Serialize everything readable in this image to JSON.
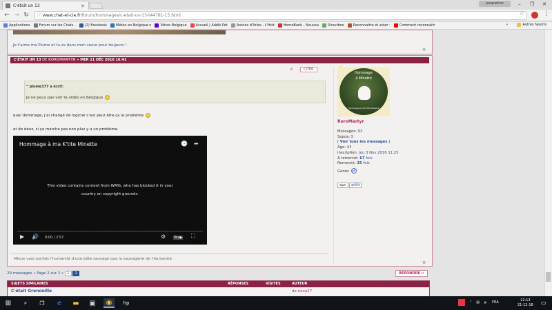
{
  "browser": {
    "tab_title": "C'était un 13",
    "user_chip": "Jacqueline",
    "url_host": "www.chat-et-cie.fr",
    "url_path": "/forum/hommages/c-etait-un-13-t44781-15.html",
    "bookmarks": [
      "Applications",
      "Forum sur les Chats -",
      "(2) Facebook",
      "Météo en Belgique n",
      "Yahoo Belgique",
      "Accueil | Addik Pet",
      "Arènes d'Arles - L'Hist",
      "HomeBank - Nouvea",
      "Shoutbox",
      "Reconnaitre et aider :",
      "Comment reconnaitr"
    ],
    "bookmarks_overflow": "»",
    "other_bookmarks": "Autres favoris"
  },
  "prev_post": {
    "signature": "Je t'aime ma Plume et tu es dans mon coeur pour toujours !"
  },
  "post": {
    "title": "C'ÉTAIT UN 13",
    "by": "DE",
    "author": "ROROMARTYR",
    "date": "» MER 21 DÉC 2016 16:41",
    "cite": "CITER",
    "quote_author": "plume377 a écrit:",
    "quote_text": "Je ne peux pas voir ta vidéo en Belgique",
    "para1": "quel dommage, j'ai changé de logiciel c'est peut être ça le problème",
    "para2": "et de deuz, si ça marche pas non plus y a un problème.",
    "video_title": "Hommage à ma K'tite Minette",
    "video_msg1": "This video contains content from WMG, who has blocked it in your",
    "video_msg2": "country on copyright grounds.",
    "video_time": "0:00 / 2:57",
    "signature": "Mieux vaut parfois l'humanité d'une bête sauvage que la sauvagerie de l'humanité."
  },
  "profile": {
    "avatar_text1": "Hommage",
    "avatar_text2": "à Minette",
    "avatar_text3": "Hommage à ma k'tite Minette",
    "name": "RoroMartyr",
    "messages_label": "Messages:",
    "messages": "93",
    "sujets_label": "Sujets:",
    "sujets": "5",
    "voir": "Voir tous les messages",
    "age_label": "Age:",
    "age": "43",
    "inscription_label": "Inscription:",
    "inscription": "Jeu 3 Nov 2016 11:25",
    "aremercie_label": "A remercié:",
    "aremercie": "67",
    "aremercie_unit": "fois",
    "remercie_label": "Remercié:",
    "remercie": "35",
    "remercie_unit": "fois",
    "genre_label": "Genre:",
    "btn_pm": "pm",
    "btn_msn": "MSN"
  },
  "pagination": {
    "text": "29 messages",
    "page_label": "• Page 2 sur 2 •",
    "pages": [
      "1",
      "2"
    ],
    "reply": "RÉPONDRE"
  },
  "similar": {
    "headers": [
      "SUJETS SIMILAIRES",
      "RÉPONSES",
      "VISITES",
      "AUTEUR"
    ],
    "first_row": "C'était Grenouille",
    "first_author": "de nova27"
  },
  "taskbar": {
    "lang": "FRA",
    "time": "22:13",
    "date": "21-12-16"
  }
}
